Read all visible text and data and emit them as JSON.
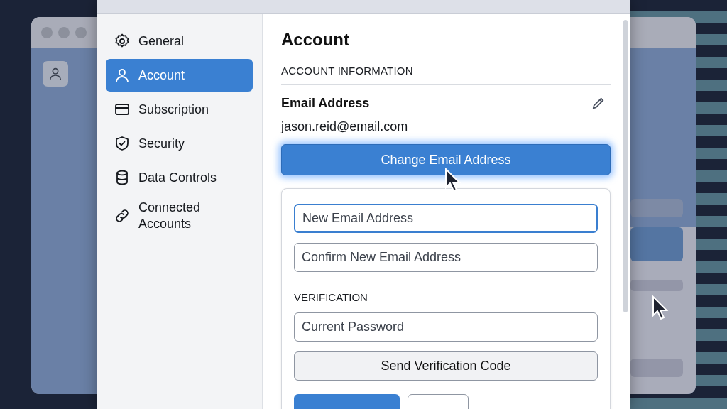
{
  "sidebar": {
    "items": [
      {
        "label": "General",
        "selected": false
      },
      {
        "label": "Account",
        "selected": true
      },
      {
        "label": "Subscription",
        "selected": false
      },
      {
        "label": "Security",
        "selected": false
      },
      {
        "label": "Data Controls",
        "selected": false
      },
      {
        "label": "Connected Accounts",
        "selected": false
      }
    ]
  },
  "content": {
    "title": "Account",
    "section": "ACCOUNT INFORMATION",
    "email_label": "Email Address",
    "email_value": "jason.reid@email.com",
    "change_button": {
      "label": "Change Email Address",
      "highlighted": true
    },
    "form": {
      "fields": [
        {
          "placeholder": "New Email Address",
          "focused": true
        },
        {
          "placeholder": "Confirm New Email Address",
          "focused": false
        }
      ],
      "verification_label": "VERIFICATION",
      "password_field": {
        "placeholder": "Current Password",
        "focused": false
      },
      "send_button": "Send Verification Code"
    }
  }
}
